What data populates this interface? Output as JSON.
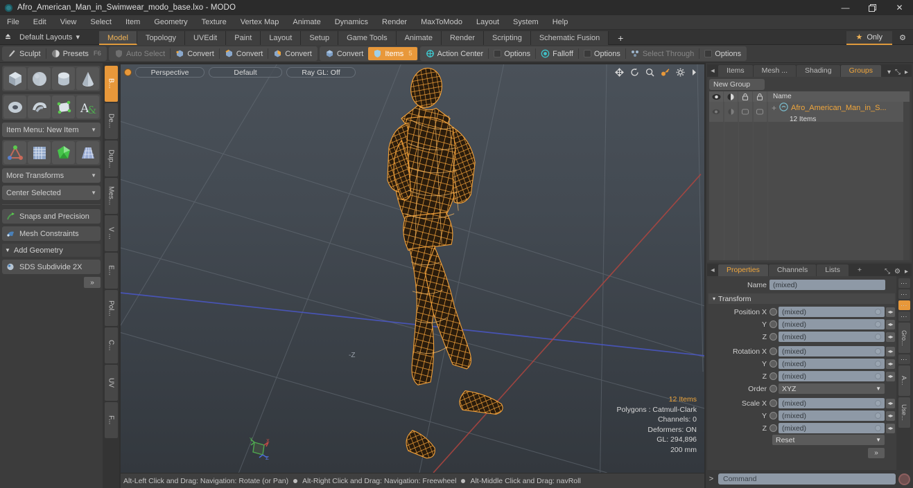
{
  "titlebar": {
    "title": "Afro_American_Man_in_Swimwear_modo_base.lxo - MODO",
    "minimize": "—",
    "restore": "❐",
    "close": "✕"
  },
  "menubar": {
    "items": [
      "File",
      "Edit",
      "View",
      "Select",
      "Item",
      "Geometry",
      "Texture",
      "Vertex Map",
      "Animate",
      "Dynamics",
      "Render",
      "MaxToModo",
      "Layout",
      "System",
      "Help"
    ]
  },
  "layoutbar": {
    "default_layouts": "Default Layouts",
    "caret": "▾",
    "tabs": [
      {
        "label": "Model",
        "active": true
      },
      {
        "label": "Topology",
        "active": false
      },
      {
        "label": "UVEdit",
        "active": false
      },
      {
        "label": "Paint",
        "active": false
      },
      {
        "label": "Layout",
        "active": false
      },
      {
        "label": "Setup",
        "active": false
      },
      {
        "label": "Game Tools",
        "active": false
      },
      {
        "label": "Animate",
        "active": false
      },
      {
        "label": "Render",
        "active": false
      },
      {
        "label": "Scripting",
        "active": false
      },
      {
        "label": "Schematic Fusion",
        "active": false
      }
    ],
    "add_tab": "+",
    "only_label": "Only",
    "star": "★",
    "gear": "⚙"
  },
  "toolbar": {
    "group1": [
      {
        "label": "Sculpt",
        "icon": "brush-icon",
        "state": "normal",
        "hint": ""
      },
      {
        "label": "Presets",
        "icon": "sphere-icon",
        "state": "normal",
        "hint": "F6"
      }
    ],
    "group2": [
      {
        "label": "Auto Select",
        "icon": "shield-grey-icon",
        "state": "dim"
      },
      {
        "label": "Convert",
        "icon": "vertex-icon",
        "state": "normal"
      },
      {
        "label": "Convert",
        "icon": "edge-icon",
        "state": "normal"
      },
      {
        "label": "Convert",
        "icon": "polygon-icon",
        "state": "normal"
      }
    ],
    "group3": [
      {
        "label": "Convert",
        "icon": "material-icon",
        "state": "normal"
      },
      {
        "label": "Items",
        "icon": "items-icon",
        "state": "on",
        "hint": "5"
      }
    ],
    "group4": [
      {
        "label": "Action Center",
        "icon": "action-center-icon",
        "state": "normal"
      },
      {
        "label": "Options",
        "icon": "checkbox-icon",
        "state": "normal"
      },
      {
        "label": "Falloff",
        "icon": "falloff-icon",
        "state": "normal"
      },
      {
        "label": "Options",
        "icon": "checkbox-icon",
        "state": "normal"
      }
    ],
    "group5": [
      {
        "label": "Select Through",
        "icon": "select-through-icon",
        "state": "dim"
      },
      {
        "label": "Options",
        "icon": "checkbox-icon",
        "state": "normal"
      }
    ]
  },
  "left_panel": {
    "primitive_tiles": [
      "cube-icon",
      "sphere-icon",
      "cylinder-icon",
      "cone-icon"
    ],
    "primitive_tiles2": [
      "torus-icon",
      "spiral-icon",
      "teapot-icon",
      "text-icon"
    ],
    "item_menu": "Item Menu: New Item",
    "tool_tiles": [
      "transform-gizmo-icon",
      "grid-mesh-icon",
      "green-crystal-icon",
      "blue-lattice-icon"
    ],
    "more_transforms": "More Transforms",
    "center_selected": "Center Selected",
    "snaps": "Snaps and Precision",
    "mesh_constraints": "Mesh Constraints",
    "add_geometry": "Add Geometry",
    "sds_subdivide": "SDS Subdivide 2X",
    "expand": "»",
    "vtabs": [
      {
        "label": "B...",
        "active": true
      },
      {
        "label": "De...",
        "active": false
      },
      {
        "label": "Dup...",
        "active": false
      },
      {
        "label": "Mes...",
        "active": false
      },
      {
        "label": "V ...",
        "active": false
      },
      {
        "label": "E...",
        "active": false
      },
      {
        "label": "Pol...",
        "active": false
      },
      {
        "label": "C...",
        "active": false
      },
      {
        "label": "UV",
        "active": false
      },
      {
        "label": "F...",
        "active": false
      }
    ]
  },
  "viewport": {
    "view_mode": "Perspective",
    "shading": "Default",
    "raygl": "Ray GL: Off",
    "icons": [
      "move-icon",
      "rotate-icon",
      "zoom-icon",
      "key-icon",
      "gear-icon",
      "chevron-right-icon"
    ],
    "axis_label_z": "-Z",
    "stats": {
      "items": "12 Items",
      "polygons": "Polygons : Catmull-Clark",
      "channels": "Channels: 0",
      "deformers": "Deformers: ON",
      "gl": "GL: 294,896",
      "scale": "200 mm"
    },
    "status": {
      "hint1": "Alt-Left Click and Drag: Navigation: Rotate (or Pan)",
      "hint2": "Alt-Right Click and Drag: Navigation: Freewheel",
      "hint3": "Alt-Middle Click and Drag: navRoll"
    }
  },
  "right_panel": {
    "top_tabs": [
      {
        "label": "Items",
        "active": false
      },
      {
        "label": "Mesh ...",
        "active": false
      },
      {
        "label": "Shading",
        "active": false
      },
      {
        "label": "Groups",
        "active": true
      }
    ],
    "top_tabs_caret": "▾",
    "expand_icon": "⤡",
    "chevron": "▸",
    "new_group": "New Group",
    "tree_columns": [
      "eye-icon",
      "shading-icon",
      "lock-icon",
      "render-icon"
    ],
    "tree_name_header": "Name",
    "tree_row": {
      "expander": "+",
      "icon": "group-icon",
      "name": "Afro_American_Man_in_S...",
      "subtitle": "12 Items"
    },
    "props_tabs": [
      {
        "label": "Properties",
        "active": true
      },
      {
        "label": "Channels",
        "active": false
      },
      {
        "label": "Lists",
        "active": false
      }
    ],
    "props_add": "+",
    "props_gear": "⚙",
    "name_label": "Name",
    "name_value": "(mixed)",
    "transform_section": "Transform",
    "transform_caret": "▾",
    "fields": [
      {
        "label": "Position X",
        "value": "(mixed)",
        "type": "num"
      },
      {
        "label": "Y",
        "value": "(mixed)",
        "type": "num"
      },
      {
        "label": "Z",
        "value": "(mixed)",
        "type": "num"
      },
      {
        "label": "Rotation X",
        "value": "(mixed)",
        "type": "num"
      },
      {
        "label": "Y",
        "value": "(mixed)",
        "type": "num"
      },
      {
        "label": "Z",
        "value": "(mixed)",
        "type": "num"
      },
      {
        "label": "Order",
        "value": "XYZ",
        "type": "select"
      },
      {
        "label": "Scale X",
        "value": "(mixed)",
        "type": "num"
      },
      {
        "label": "Y",
        "value": "(mixed)",
        "type": "num"
      },
      {
        "label": "Z",
        "value": "(mixed)",
        "type": "num"
      }
    ],
    "reset": "Reset",
    "go_button": "»",
    "side_tabs": [
      {
        "label": "Gro...",
        "active": false
      },
      {
        "label": "A...",
        "active": false
      },
      {
        "label": "Use...",
        "active": false
      }
    ],
    "command_prefix": ">",
    "command_placeholder": "Command"
  },
  "colors": {
    "accent": "#e8983a",
    "wireframe": "#f2a13a",
    "teal": "#3fc2c9",
    "axis_x": "#c24b45",
    "axis_z": "#4a57c8",
    "axis_y": "#4fa84f"
  }
}
